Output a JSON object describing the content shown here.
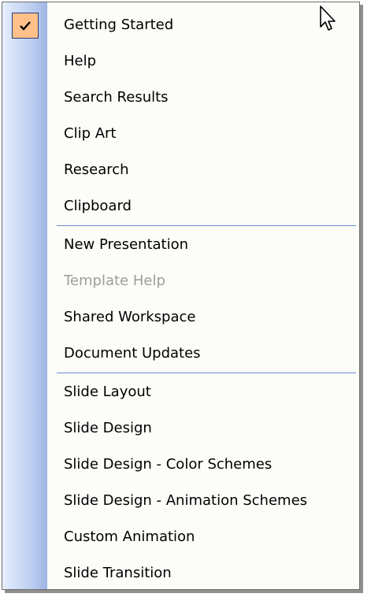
{
  "menu": {
    "items": [
      {
        "label": "Getting Started",
        "checked": true,
        "enabled": true
      },
      {
        "label": "Help",
        "checked": false,
        "enabled": true
      },
      {
        "label": "Search Results",
        "checked": false,
        "enabled": true
      },
      {
        "label": "Clip Art",
        "checked": false,
        "enabled": true
      },
      {
        "label": "Research",
        "checked": false,
        "enabled": true
      },
      {
        "label": "Clipboard",
        "checked": false,
        "enabled": true
      },
      {
        "label": "New Presentation",
        "checked": false,
        "enabled": true
      },
      {
        "label": "Template Help",
        "checked": false,
        "enabled": false
      },
      {
        "label": "Shared Workspace",
        "checked": false,
        "enabled": true
      },
      {
        "label": "Document Updates",
        "checked": false,
        "enabled": true
      },
      {
        "label": "Slide Layout",
        "checked": false,
        "enabled": true
      },
      {
        "label": "Slide Design",
        "checked": false,
        "enabled": true
      },
      {
        "label": "Slide Design - Color Schemes",
        "checked": false,
        "enabled": true
      },
      {
        "label": "Slide Design - Animation Schemes",
        "checked": false,
        "enabled": true
      },
      {
        "label": "Custom Animation",
        "checked": false,
        "enabled": true
      },
      {
        "label": "Slide Transition",
        "checked": false,
        "enabled": true
      }
    ]
  },
  "colors": {
    "check_highlight": "#ffc08a",
    "separator": "#6a8cd8",
    "disabled_text": "#9d9d9d",
    "gutter": "#b9cbef"
  },
  "icons": {
    "check": "check-icon",
    "cursor": "mouse-pointer-icon"
  }
}
